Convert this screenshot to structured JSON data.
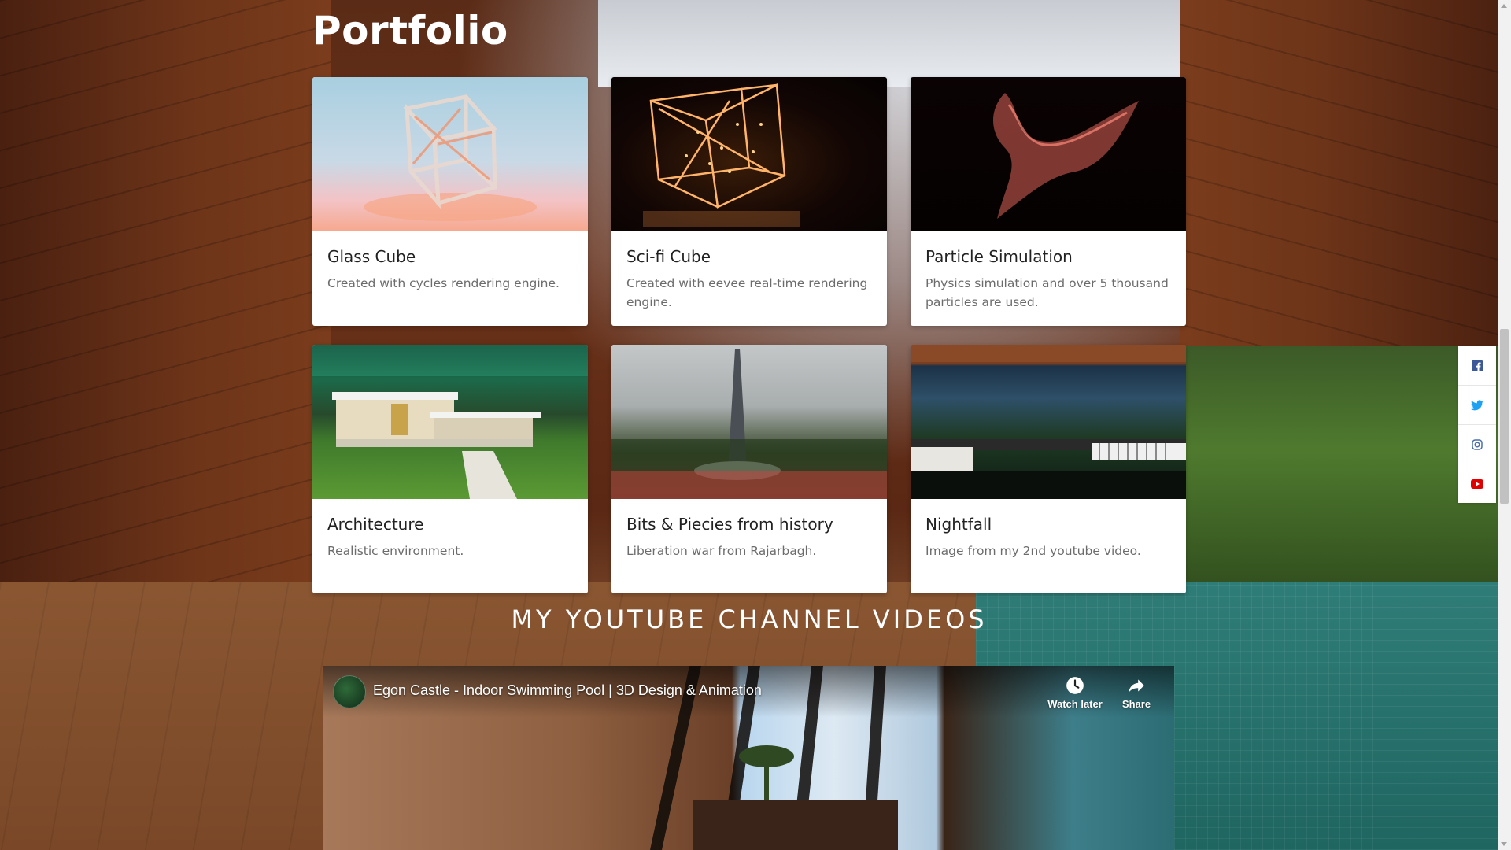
{
  "portfolio": {
    "title": "Portfolio",
    "cards": [
      {
        "title": "Glass Cube",
        "text": "Created with cycles rendering engine."
      },
      {
        "title": "Sci-fi Cube",
        "text": "Created with eevee real-time rendering engine."
      },
      {
        "title": "Particle Simulation",
        "text": "Physics simulation and over 5 thousand particles are used."
      },
      {
        "title": "Architecture",
        "text": "Realistic environment."
      },
      {
        "title": "Bits & Piecies from history",
        "text": "Liberation war from Rajarbagh."
      },
      {
        "title": "Nightfall",
        "text": "Image from my 2nd youtube video."
      }
    ]
  },
  "youtube": {
    "heading": "MY YOUTUBE CHANNEL VIDEOS",
    "video": {
      "title": "Egon Castle - Indoor Swimming Pool | 3D Design & Animation",
      "watch_later_label": "Watch later",
      "share_label": "Share"
    }
  },
  "social": {
    "items": [
      {
        "name": "facebook",
        "icon": "facebook-icon",
        "color": "#3b5998"
      },
      {
        "name": "twitter",
        "icon": "twitter-icon",
        "color": "#1da1f2"
      },
      {
        "name": "instagram",
        "icon": "instagram-icon",
        "color": "#4a6ea9"
      },
      {
        "name": "youtube",
        "icon": "youtube-icon",
        "color": "#e00000"
      }
    ]
  }
}
